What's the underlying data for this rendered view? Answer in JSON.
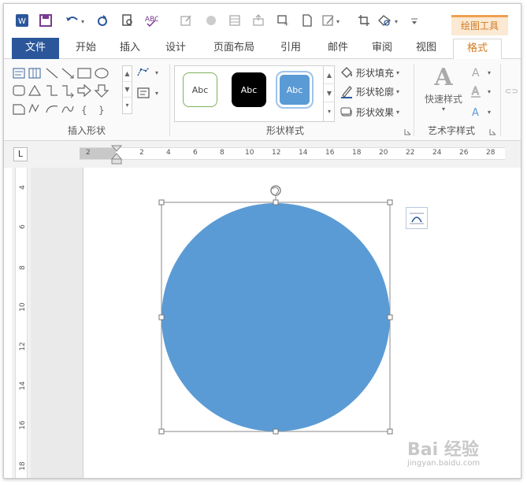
{
  "context_tool": "绘图工具",
  "tabs": [
    {
      "label": "文件"
    },
    {
      "label": "开始"
    },
    {
      "label": "插入"
    },
    {
      "label": "设计"
    },
    {
      "label": "页面布局"
    },
    {
      "label": "引用"
    },
    {
      "label": "邮件"
    },
    {
      "label": "审阅"
    },
    {
      "label": "视图"
    },
    {
      "label": "格式"
    }
  ],
  "ribbon": {
    "insert_shapes_label": "插入形状",
    "shape_styles_label": "形状样式",
    "wordart_label": "艺术字样式",
    "style_samples": [
      "Abc",
      "Abc",
      "Abc"
    ],
    "shape_fill": "形状填充",
    "shape_outline": "形状轮廓",
    "shape_effects": "形状效果",
    "quick_styles": "快速样式"
  },
  "ruler": {
    "horizontal_ticks": [
      "2",
      "2",
      "4",
      "6",
      "8",
      "10",
      "12",
      "14",
      "16",
      "18",
      "20",
      "22",
      "24",
      "26",
      "28"
    ],
    "vertical_ticks": [
      "4",
      "6",
      "8",
      "10",
      "12",
      "14",
      "16",
      "18"
    ],
    "tab_selector": "L"
  },
  "drawing": {
    "shape": "circle",
    "fill_color": "#5b9bd5",
    "selected": true
  },
  "watermark": {
    "text": "Bai 经验",
    "sub": "jingyan.baidu.com"
  },
  "colors": {
    "file_tab": "#2b579a",
    "accent_orange": "#d27a20",
    "context_bg": "#fbe9d3"
  }
}
